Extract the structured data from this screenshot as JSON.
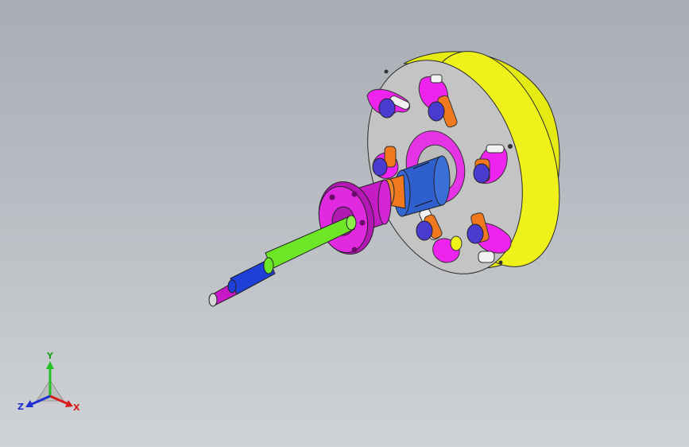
{
  "viewport": {
    "background_top": "#a8adb4",
    "background_bottom": "#cfd2d6"
  },
  "model": {
    "parts": [
      {
        "name": "fixture-plate",
        "color": "#eef21a"
      },
      {
        "name": "plate-face",
        "color": "#c2c2c2"
      },
      {
        "name": "clamp-arm",
        "color": "#ee24ee"
      },
      {
        "name": "clamp-bolt",
        "color": "#4a3bd0"
      },
      {
        "name": "clamp-spacer",
        "color": "#f0781e"
      },
      {
        "name": "hub-flange",
        "color": "#d020d0"
      },
      {
        "name": "coupling",
        "color": "#3b6fd8"
      },
      {
        "name": "shaft-green",
        "color": "#6ee628"
      },
      {
        "name": "shaft-blue",
        "color": "#1f3fd9"
      },
      {
        "name": "shaft-tip",
        "color": "#c818c8"
      }
    ]
  },
  "triad": {
    "x_label": "X",
    "y_label": "Y",
    "z_label": "Z",
    "x_color": "#d81c1c",
    "y_color": "#22c022",
    "z_color": "#2030d0"
  }
}
